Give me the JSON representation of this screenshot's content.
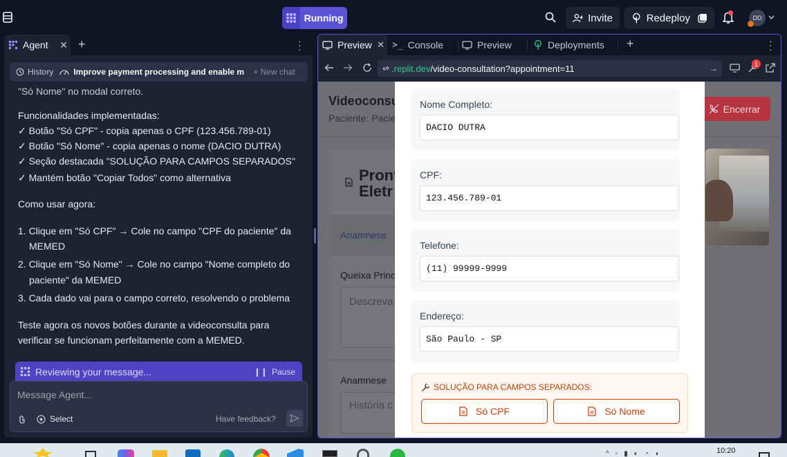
{
  "topbar": {
    "run_label": "Running",
    "invite_label": "Invite",
    "redeploy_label": "Redeploy",
    "avatar_initials": "DD"
  },
  "agent": {
    "tab_label": "Agent",
    "history_label": "History",
    "chat_title": "Improve payment processing and enable m...",
    "new_chat_label": "+ New chat",
    "messages": [
      "\"Só Nome\" no modal correto.",
      "Funcionalidades implementadas:",
      "✓ Botão \"Só CPF\" - copia apenas o CPF (123.456.789-01)",
      "✓ Botão \"Só Nome\" - copia apenas o nome (DACIO DUTRA)",
      "✓ Seção destacada \"SOLUÇÃO PARA CAMPOS SEPARADOS\"",
      "✓ Mantém botão \"Copiar Todos\" como alternativa",
      "Como usar agora:",
      "1. Clique em \"Só CPF\" → Cole no campo \"CPF do paciente\" da",
      "MEMED",
      "2. Clique em \"Só Nome\" → Cole no campo \"Nome completo do",
      "paciente\" da MEMED",
      "3. Cada dado vai para o campo correto, resolvendo o problema",
      "Teste agora os novos botões durante a videoconsulta para",
      "verificar se funcionam perfeitamente com a MEMED."
    ],
    "status_text": "Reviewing your message...",
    "pause_label": "Pause",
    "input_placeholder": "Message Agent...",
    "select_label": "Select",
    "feedback_label": "Have feedback?"
  },
  "preview": {
    "tabs": [
      "Preview",
      "Console",
      "Preview",
      "Deployments"
    ],
    "url_domain": ".replit.dev",
    "url_path": "/video-consultation?appointment=11",
    "badge_count": "1",
    "page": {
      "title": "Videoconsu",
      "subtitle": "Paciente: Pacie",
      "end_button": "Encerrar",
      "record_title_1": "Pront",
      "record_title_2": "Eletr",
      "tab_anamnese": "Anamnese",
      "field_queixa": "Queixa Princ",
      "field_queixa_placeholder": "Descreva",
      "field_anamnese": "Anamnese",
      "field_anamnese_placeholder": "História c"
    },
    "modal": {
      "fields": [
        {
          "label": "Nome Completo:",
          "value": "DACIO DUTRA"
        },
        {
          "label": "CPF:",
          "value": "123.456.789-01"
        },
        {
          "label": "Telefone:",
          "value": "(11) 99999-9999"
        },
        {
          "label": "Endereço:",
          "value": "São Paulo - SP"
        }
      ],
      "solution_title": "SOLUÇÃO PARA CAMPOS SEPARADOS:",
      "cpf_button": "Só CPF",
      "name_button": "Só Nome"
    }
  },
  "taskbar": {
    "time": "10:20"
  },
  "colors": {
    "accent": "#5b53d6",
    "danger": "#dc3545",
    "orange": "#c2410c",
    "url_green": "#33c78a"
  }
}
